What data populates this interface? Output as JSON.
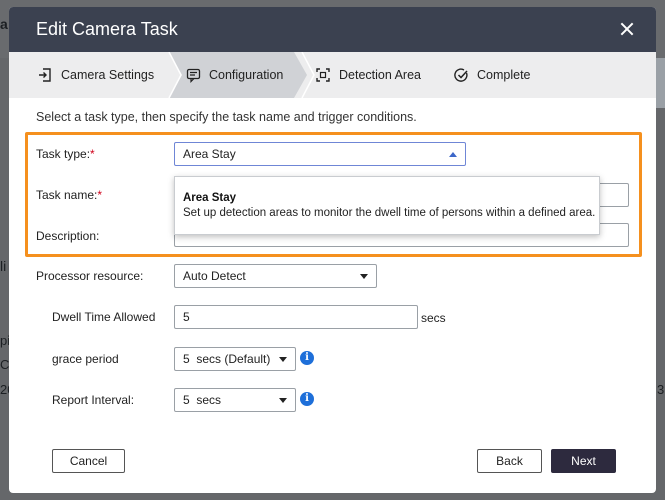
{
  "dialog": {
    "title": "Edit Camera Task",
    "steps": [
      {
        "label": "Camera Settings",
        "icon": "login-arrow-icon"
      },
      {
        "label": "Configuration",
        "icon": "config-chat-icon"
      },
      {
        "label": "Detection Area",
        "icon": "focus-frame-icon"
      },
      {
        "label": "Complete",
        "icon": "check-circle-icon"
      }
    ],
    "active_step": 1,
    "intro": "Select a task type, then specify the task name and trigger conditions."
  },
  "form": {
    "task_type_label": "Task type:",
    "task_type_value": "Area Stay",
    "task_name_label": "Task name:",
    "description_label": "Description:",
    "required_mark": "*",
    "processor_label": "Processor resource:",
    "processor_value": "Auto Detect",
    "dwell_label": "Dwell Time Allowed",
    "dwell_value": "5",
    "dwell_unit": "secs",
    "grace_label": "grace period",
    "grace_value": "5  secs (Default)",
    "report_label": "Report Interval:",
    "report_value": "5  secs"
  },
  "dropdown": {
    "option_title": "Area Stay",
    "option_desc": "Set up detection areas to monitor the dwell time of persons within a defined area."
  },
  "buttons": {
    "cancel": "Cancel",
    "back": "Back",
    "next": "Next"
  },
  "background": {
    "frag1": "a",
    "frag2": "li",
    "frag3": "pi",
    "frag4": "C",
    "frag5": "20",
    "frag6": "3"
  },
  "colors": {
    "header_bg": "#3b4150",
    "highlight": "#f5901e",
    "primary_button": "#2d2a3e",
    "info": "#1e6fd9"
  }
}
